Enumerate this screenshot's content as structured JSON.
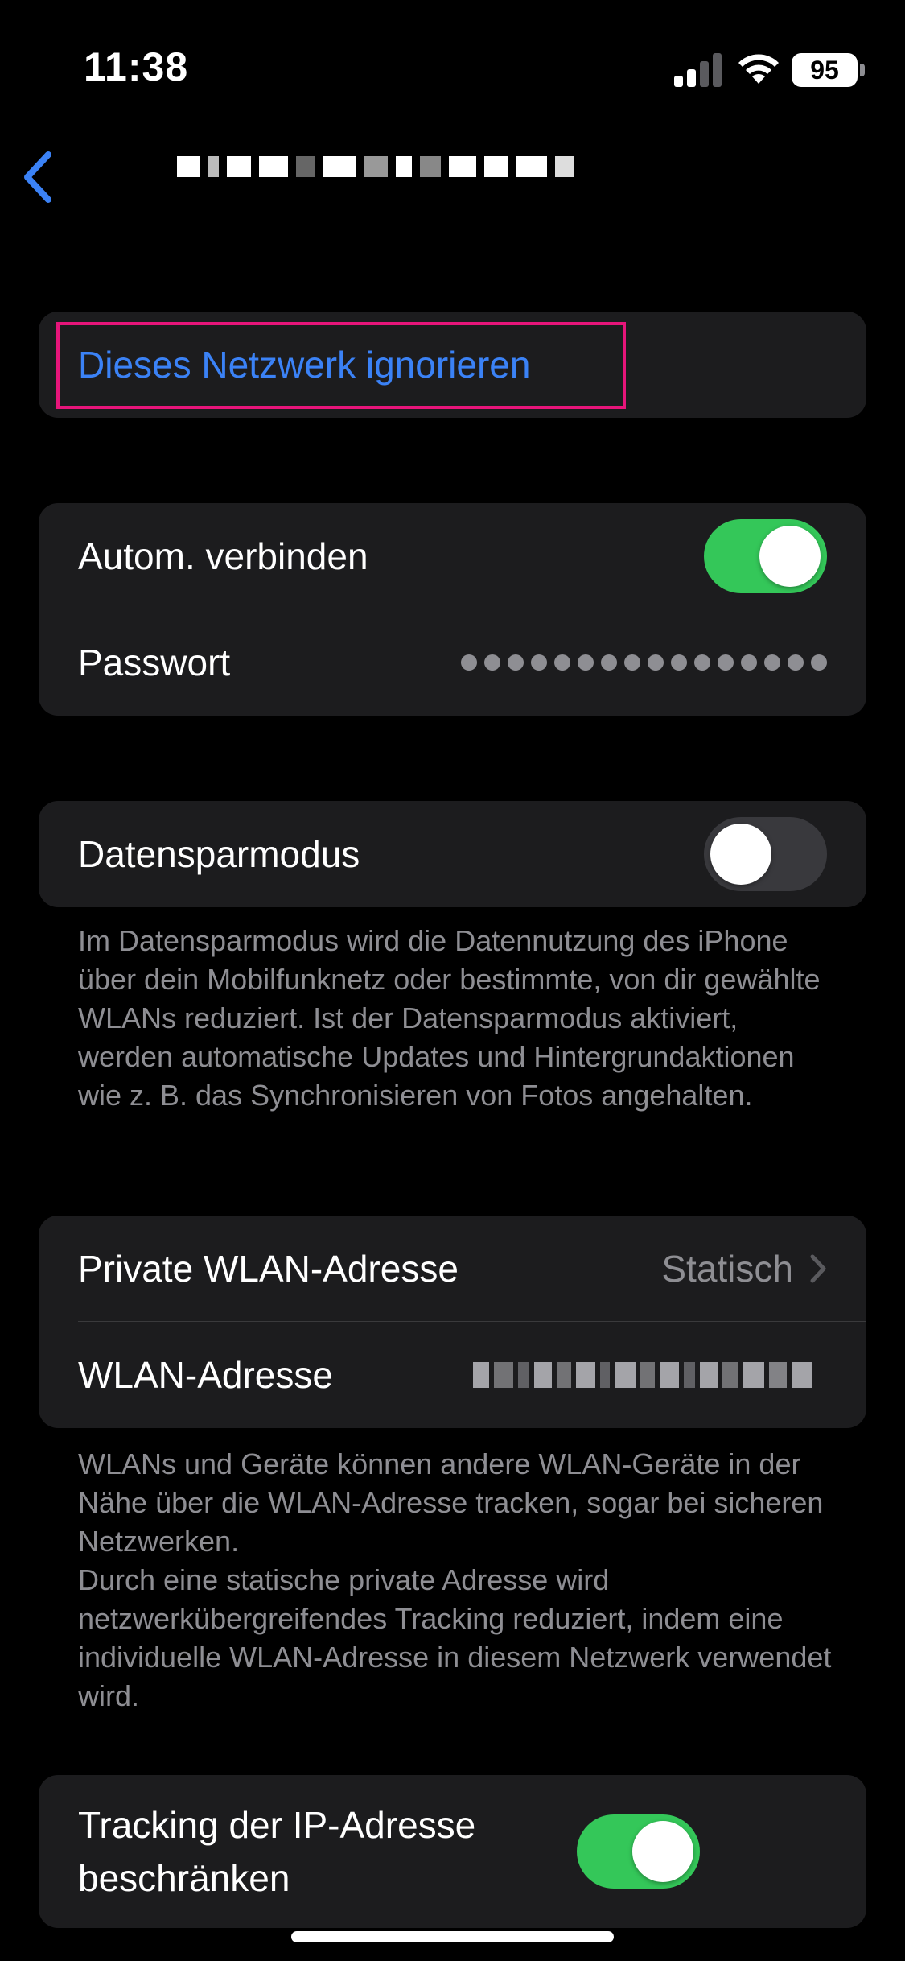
{
  "status_bar": {
    "time": "11:38",
    "battery": "95",
    "icons": [
      "signal-icon",
      "wifi-icon",
      "battery-icon"
    ]
  },
  "nav": {
    "back_icon": "chevron-left-icon"
  },
  "forget": {
    "label": "Dieses Netzwerk ignorieren",
    "color": "#3b82f6",
    "highlight_color": "#e6157a"
  },
  "connection": {
    "auto_join_label": "Autom. verbinden",
    "auto_join_on": true,
    "password_label": "Passwort"
  },
  "low_data": {
    "label": "Datensparmodus",
    "on": false,
    "footnote": "Im Datensparmodus wird die Datennutzung des iPhone über dein Mobilfunknetz oder bestimmte, von dir gewählte WLANs reduziert. Ist der Daten­sparmodus aktiviert, werden automatische Updates und Hintergrundaktionen wie z. B. das Synchronisieren von Fotos angehalten."
  },
  "address": {
    "private_label": "Private WLAN-Adresse",
    "private_value": "Statisch",
    "wlan_label": "WLAN-Adresse",
    "footnote_1": "WLANs und Geräte können andere WLAN-Geräte in der Nähe über die WLAN-Adresse tracken, sogar bei sicheren Netzwerken.",
    "footnote_2": "Durch eine statische private Adresse wird netzwerkübergreifendes Tracking reduziert, indem eine individuelle WLAN-Adresse in diesem Netzwerk verwendet wird."
  },
  "ip_tracking": {
    "label": "Tracking der IP-Adresse beschränken",
    "on": true
  },
  "colors": {
    "toggle_on": "#34c759",
    "toggle_off": "#39393d",
    "group_bg": "#1c1c1e",
    "secondary_text": "#8e8e93"
  }
}
